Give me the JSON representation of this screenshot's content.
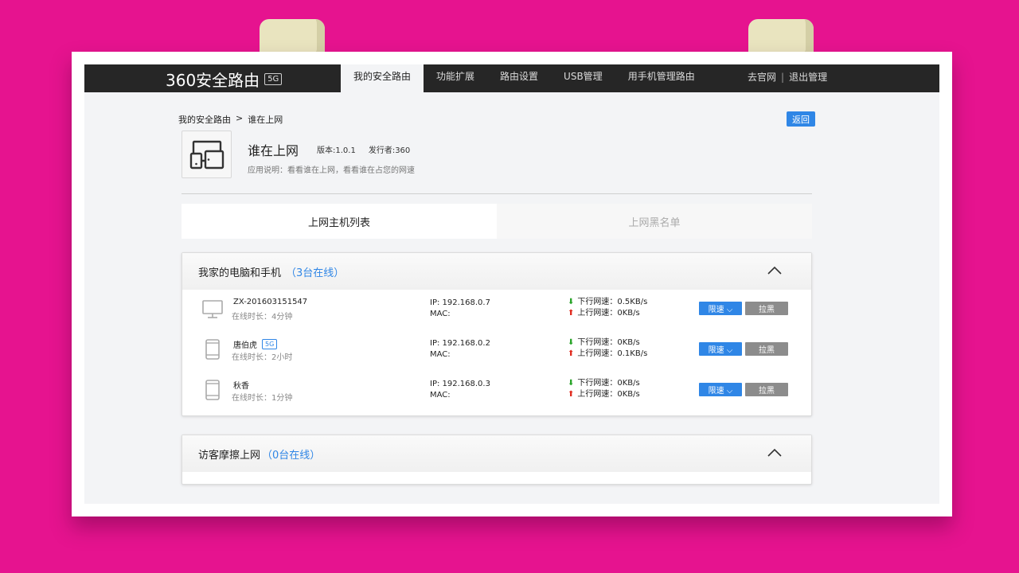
{
  "header": {
    "logo_text": "360安全路由",
    "logo_badge": "5G",
    "nav": [
      "我的安全路由",
      "功能扩展",
      "路由设置",
      "USB管理",
      "用手机管理路由"
    ],
    "official_site": "去官网",
    "divider": "|",
    "logout": "退出管理"
  },
  "breadcrumb": {
    "home": "我的安全路由",
    "separator": ">",
    "current": "谁在上网"
  },
  "back_label": "返回",
  "app": {
    "title": "谁在上网",
    "version": "版本:1.0.1",
    "publisher": "发行者:360",
    "description": "应用说明：看看谁在上网，看看谁在占您的网速"
  },
  "tabs": [
    "上网主机列表",
    "上网黑名单"
  ],
  "devices_panel": {
    "title": "我家的电脑和手机",
    "count": "（3台在线）",
    "devices": [
      {
        "icon": "monitor-icon",
        "name": "ZX-201603151547",
        "band": "",
        "online": "在线时长：4分钟",
        "ip": "IP: 192.168.0.7",
        "mac": "MAC:",
        "down": "下行网速：0.5KB/s",
        "up": "上行网速：0KB/s"
      },
      {
        "icon": "phone-icon",
        "name": "唐伯虎",
        "band": "5G",
        "online": "在线时长：2小时",
        "ip": "IP: 192.168.0.2",
        "mac": "MAC:",
        "down": "下行网速：0KB/s",
        "up": "上行网速：0.1KB/s"
      },
      {
        "icon": "phone-icon",
        "name": "秋香",
        "band": "",
        "online": "在线时长：1分钟",
        "ip": "IP: 192.168.0.3",
        "mac": "MAC:",
        "down": "下行网速：0KB/s",
        "up": "上行网速：0KB/s"
      }
    ],
    "limit_label": "限速",
    "block_label": "拉黑"
  },
  "guest_panel": {
    "title": "访客摩擦上网",
    "count": "（0台在线）"
  },
  "colors": {
    "accent": "#2f86e6",
    "topbar": "#262626",
    "background": "#e6138f"
  }
}
